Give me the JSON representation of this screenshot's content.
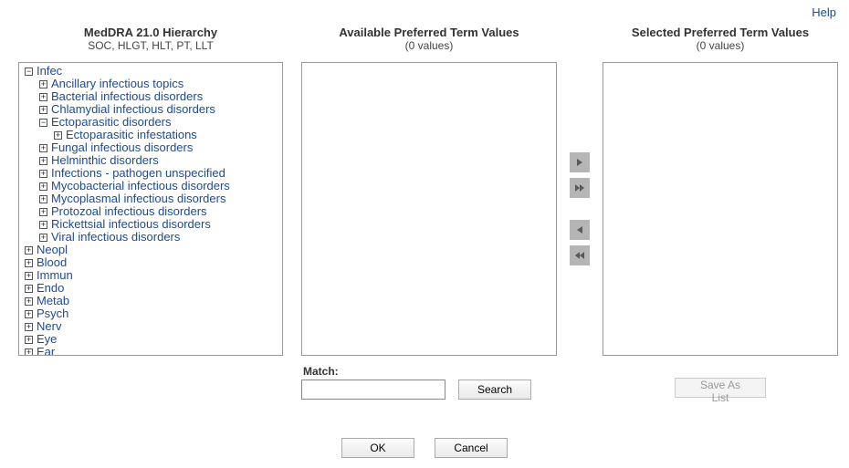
{
  "help_label": "Help",
  "columns": {
    "hierarchy": {
      "title": "MedDRA 21.0 Hierarchy",
      "subtitle": "SOC, HLGT, HLT, PT, LLT"
    },
    "available": {
      "title": "Available Preferred Term Values",
      "subtitle": "(0 values)"
    },
    "selected": {
      "title": "Selected Preferred Term Values",
      "subtitle": "(0 values)"
    }
  },
  "tree": [
    {
      "label": "Infec",
      "expanded": true,
      "children": [
        {
          "label": "Ancillary infectious topics",
          "expanded": false,
          "children": []
        },
        {
          "label": "Bacterial infectious disorders",
          "expanded": false,
          "children": []
        },
        {
          "label": "Chlamydial infectious disorders",
          "expanded": false,
          "children": []
        },
        {
          "label": "Ectoparasitic disorders",
          "expanded": true,
          "children": [
            {
              "label": "Ectoparasitic infestations",
              "expanded": false,
              "children": []
            }
          ]
        },
        {
          "label": "Fungal infectious disorders",
          "expanded": false,
          "children": []
        },
        {
          "label": "Helminthic disorders",
          "expanded": false,
          "children": []
        },
        {
          "label": "Infections - pathogen unspecified",
          "expanded": false,
          "children": []
        },
        {
          "label": "Mycobacterial infectious disorders",
          "expanded": false,
          "children": []
        },
        {
          "label": "Mycoplasmal infectious disorders",
          "expanded": false,
          "children": []
        },
        {
          "label": "Protozoal infectious disorders",
          "expanded": false,
          "children": []
        },
        {
          "label": "Rickettsial infectious disorders",
          "expanded": false,
          "children": []
        },
        {
          "label": "Viral infectious disorders",
          "expanded": false,
          "children": []
        }
      ]
    },
    {
      "label": "Neopl",
      "expanded": false,
      "children": []
    },
    {
      "label": "Blood",
      "expanded": false,
      "children": []
    },
    {
      "label": "Immun",
      "expanded": false,
      "children": []
    },
    {
      "label": "Endo",
      "expanded": false,
      "children": []
    },
    {
      "label": "Metab",
      "expanded": false,
      "children": []
    },
    {
      "label": "Psych",
      "expanded": false,
      "children": []
    },
    {
      "label": "Nerv",
      "expanded": false,
      "children": []
    },
    {
      "label": "Eye",
      "expanded": false,
      "children": []
    },
    {
      "label": "Ear",
      "expanded": false,
      "children": []
    }
  ],
  "match": {
    "label": "Match:",
    "value": "",
    "search_label": "Search"
  },
  "save_list_label": "Save As List",
  "ok_label": "OK",
  "cancel_label": "Cancel"
}
